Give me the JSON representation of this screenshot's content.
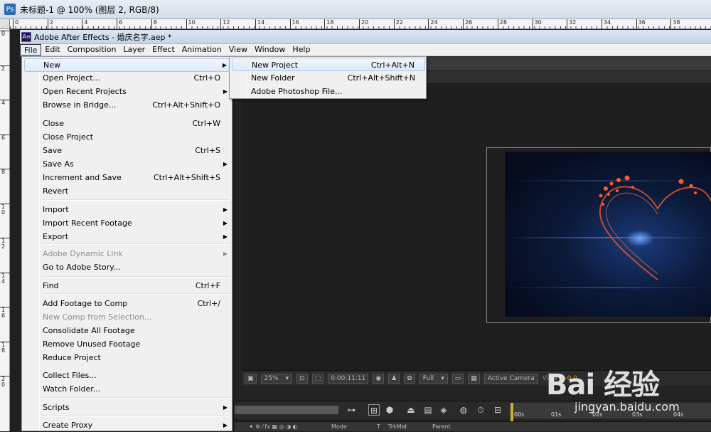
{
  "host_window": {
    "title": "未标题-1 @ 100% (图层 2, RGB/8)",
    "icon": "ps-icon"
  },
  "ruler_h": [
    "0",
    "2",
    "4",
    "6",
    "8",
    "10",
    "12",
    "14",
    "16",
    "18",
    "20",
    "22",
    "24",
    "26",
    "28",
    "30",
    "32",
    "34",
    "36",
    "38"
  ],
  "ruler_v": [
    "0",
    "2",
    "4",
    "6",
    "8",
    "1 0",
    "1 2",
    "1 4",
    "1 6",
    "1 8",
    "2 0"
  ],
  "ae_window": {
    "title": "Adobe After Effects - 婚庆名字.aep *",
    "icon_text": "Ae"
  },
  "menubar": [
    "File",
    "Edit",
    "Composition",
    "Layer",
    "Effect",
    "Animation",
    "View",
    "Window",
    "Help"
  ],
  "file_menu": {
    "items": [
      {
        "label": "New",
        "shortcut": "",
        "submenu": true
      },
      {
        "label": "Open Project...",
        "shortcut": "Ctrl+O"
      },
      {
        "label": "Open Recent Projects",
        "shortcut": "",
        "submenu": true
      },
      {
        "label": "Browse in Bridge...",
        "shortcut": "Ctrl+Alt+Shift+O"
      },
      {
        "label": "Close",
        "shortcut": "Ctrl+W"
      },
      {
        "label": "Close Project",
        "shortcut": ""
      },
      {
        "label": "Save",
        "shortcut": "Ctrl+S"
      },
      {
        "label": "Save As",
        "shortcut": "",
        "submenu": true
      },
      {
        "label": "Increment and Save",
        "shortcut": "Ctrl+Alt+Shift+S"
      },
      {
        "label": "Revert",
        "shortcut": ""
      },
      {
        "label": "Import",
        "shortcut": "",
        "submenu": true
      },
      {
        "label": "Import Recent Footage",
        "shortcut": "",
        "submenu": true
      },
      {
        "label": "Export",
        "shortcut": "",
        "submenu": true
      },
      {
        "label": "Adobe Dynamic Link",
        "shortcut": "",
        "submenu": true,
        "disabled": true
      },
      {
        "label": "Go to Adobe Story...",
        "shortcut": ""
      },
      {
        "label": "Find",
        "shortcut": "Ctrl+F"
      },
      {
        "label": "Add Footage to Comp",
        "shortcut": "Ctrl+/"
      },
      {
        "label": "New Comp from Selection...",
        "shortcut": "",
        "disabled": true
      },
      {
        "label": "Consolidate All Footage",
        "shortcut": ""
      },
      {
        "label": "Remove Unused Footage",
        "shortcut": ""
      },
      {
        "label": "Reduce Project",
        "shortcut": ""
      },
      {
        "label": "Collect Files...",
        "shortcut": ""
      },
      {
        "label": "Watch Folder...",
        "shortcut": ""
      },
      {
        "label": "Scripts",
        "shortcut": "",
        "submenu": true
      },
      {
        "label": "Create Proxy",
        "shortcut": "",
        "submenu": true
      }
    ]
  },
  "new_submenu": {
    "items": [
      {
        "label": "New Project",
        "shortcut": "Ctrl+Alt+N"
      },
      {
        "label": "New Folder",
        "shortcut": "Ctrl+Alt+Shift+N"
      },
      {
        "label": "Adobe Photoshop File...",
        "shortcut": ""
      }
    ]
  },
  "viewer_toolbar": {
    "zoom": "25%",
    "timecode": "0:00:11:11",
    "resolution": "Full",
    "camera": "Active Camera",
    "view": "View",
    "exposure": "+0.0"
  },
  "timeline": {
    "ticks": [
      "00s",
      "01s",
      "02s",
      "03s",
      "04s"
    ],
    "columns": [
      "Mode",
      "T",
      "TrkMat",
      "Parent"
    ]
  },
  "watermark": {
    "logo": "Bai 经验",
    "url": "jingyan.baidu.com"
  }
}
